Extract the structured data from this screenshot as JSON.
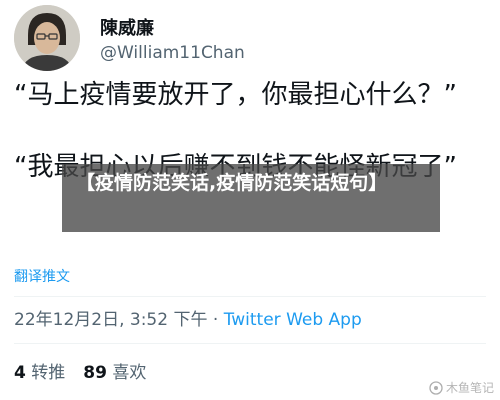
{
  "user": {
    "display_name": "陳威廉",
    "handle": "@William11Chan",
    "avatar_icon": "person-avatar"
  },
  "tweet": {
    "paragraph1": "“马上疫情要放开了，你最担心什么？”",
    "paragraph2": "“我最担心以后赚不到钱不能怪新冠了”",
    "translate_label": "翻译推文"
  },
  "meta": {
    "time": "22年12月2日, 3:52 下午",
    "separator": " · ",
    "source": "Twitter Web App"
  },
  "stats": {
    "retweets_count": "4",
    "retweets_label": "转推",
    "likes_count": "89",
    "likes_label": "喜欢"
  },
  "overlay": {
    "title": "【疫情防范笑话,疫情防范笑话短句】"
  },
  "watermark": {
    "text": "木鱼笔记",
    "icon": "watermark-logo-icon"
  },
  "colors": {
    "link": "#1d9bf0",
    "secondary_text": "#536471",
    "primary_text": "#0f1419",
    "banner_bg": "#464646"
  }
}
